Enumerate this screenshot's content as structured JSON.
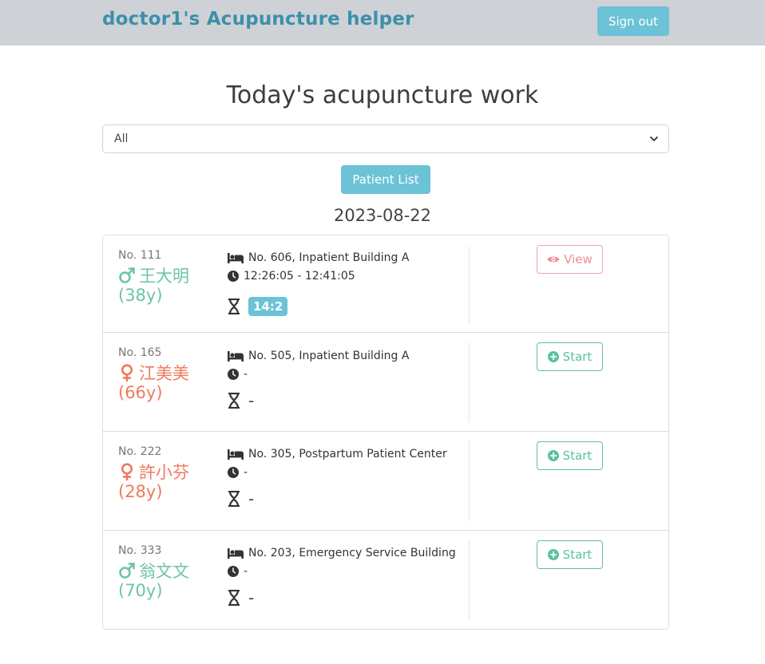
{
  "header": {
    "brand": "doctor1's Acupuncture helper",
    "signout_label": "Sign out"
  },
  "main": {
    "title": "Today's acupuncture work",
    "filter": {
      "selected": "All"
    },
    "patient_list_label": "Patient List",
    "date": "2023-08-22"
  },
  "patients": [
    {
      "no": "No. 111",
      "name": "王大明",
      "gender": "male",
      "age": "(38y)",
      "location": "No. 606, Inpatient Building A",
      "time": "12:26:05 - 12:41:05",
      "timer": "14:2",
      "action": "View"
    },
    {
      "no": "No. 165",
      "name": "江美美",
      "gender": "female",
      "age": "(66y)",
      "location": "No. 505, Inpatient Building A",
      "time": "-",
      "timer": "-",
      "action": "Start"
    },
    {
      "no": "No. 222",
      "name": "許小芬",
      "gender": "female",
      "age": "(28y)",
      "location": "No. 305, Postpartum Patient Center",
      "time": "-",
      "timer": "-",
      "action": "Start"
    },
    {
      "no": "No. 333",
      "name": "翁文文",
      "gender": "male",
      "age": "(70y)",
      "location": "No. 203, Emergency Service Building",
      "time": "-",
      "timer": "-",
      "action": "Start"
    }
  ],
  "colors": {
    "brand": "#3d8fa9",
    "info_button": "#6cc2d6",
    "male": "#6cc3ab",
    "female": "#ef7a5c",
    "view": "#ef8c92",
    "start": "#5bc39a"
  },
  "icons": {
    "bed": "bed-icon",
    "clock": "clock-icon",
    "timer": "hourglass-icon",
    "view": "eye-icon",
    "start": "plus-circle-icon",
    "male": "male-icon",
    "female": "female-icon",
    "select": "chevron-down-icon"
  }
}
